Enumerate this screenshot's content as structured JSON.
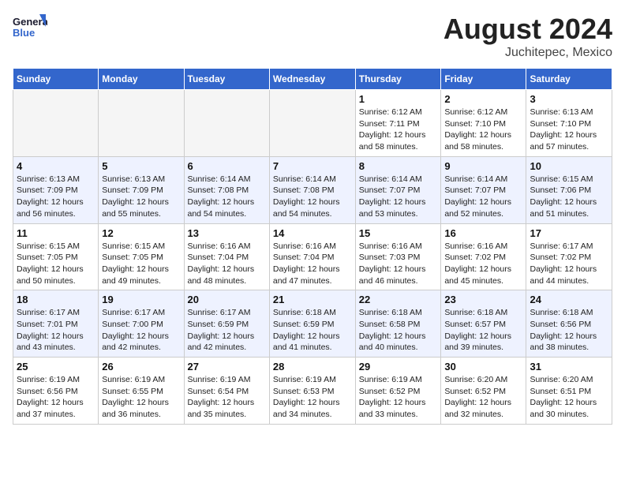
{
  "logo": {
    "line1": "General",
    "line2": "Blue"
  },
  "title": "August 2024",
  "location": "Juchitepec, Mexico",
  "weekdays": [
    "Sunday",
    "Monday",
    "Tuesday",
    "Wednesday",
    "Thursday",
    "Friday",
    "Saturday"
  ],
  "weeks": [
    [
      {
        "day": "",
        "info": "",
        "empty": true
      },
      {
        "day": "",
        "info": "",
        "empty": true
      },
      {
        "day": "",
        "info": "",
        "empty": true
      },
      {
        "day": "",
        "info": "",
        "empty": true
      },
      {
        "day": "1",
        "info": "Sunrise: 6:12 AM\nSunset: 7:11 PM\nDaylight: 12 hours\nand 58 minutes."
      },
      {
        "day": "2",
        "info": "Sunrise: 6:12 AM\nSunset: 7:10 PM\nDaylight: 12 hours\nand 58 minutes."
      },
      {
        "day": "3",
        "info": "Sunrise: 6:13 AM\nSunset: 7:10 PM\nDaylight: 12 hours\nand 57 minutes."
      }
    ],
    [
      {
        "day": "4",
        "info": "Sunrise: 6:13 AM\nSunset: 7:09 PM\nDaylight: 12 hours\nand 56 minutes."
      },
      {
        "day": "5",
        "info": "Sunrise: 6:13 AM\nSunset: 7:09 PM\nDaylight: 12 hours\nand 55 minutes."
      },
      {
        "day": "6",
        "info": "Sunrise: 6:14 AM\nSunset: 7:08 PM\nDaylight: 12 hours\nand 54 minutes."
      },
      {
        "day": "7",
        "info": "Sunrise: 6:14 AM\nSunset: 7:08 PM\nDaylight: 12 hours\nand 54 minutes."
      },
      {
        "day": "8",
        "info": "Sunrise: 6:14 AM\nSunset: 7:07 PM\nDaylight: 12 hours\nand 53 minutes."
      },
      {
        "day": "9",
        "info": "Sunrise: 6:14 AM\nSunset: 7:07 PM\nDaylight: 12 hours\nand 52 minutes."
      },
      {
        "day": "10",
        "info": "Sunrise: 6:15 AM\nSunset: 7:06 PM\nDaylight: 12 hours\nand 51 minutes."
      }
    ],
    [
      {
        "day": "11",
        "info": "Sunrise: 6:15 AM\nSunset: 7:05 PM\nDaylight: 12 hours\nand 50 minutes."
      },
      {
        "day": "12",
        "info": "Sunrise: 6:15 AM\nSunset: 7:05 PM\nDaylight: 12 hours\nand 49 minutes."
      },
      {
        "day": "13",
        "info": "Sunrise: 6:16 AM\nSunset: 7:04 PM\nDaylight: 12 hours\nand 48 minutes."
      },
      {
        "day": "14",
        "info": "Sunrise: 6:16 AM\nSunset: 7:04 PM\nDaylight: 12 hours\nand 47 minutes."
      },
      {
        "day": "15",
        "info": "Sunrise: 6:16 AM\nSunset: 7:03 PM\nDaylight: 12 hours\nand 46 minutes."
      },
      {
        "day": "16",
        "info": "Sunrise: 6:16 AM\nSunset: 7:02 PM\nDaylight: 12 hours\nand 45 minutes."
      },
      {
        "day": "17",
        "info": "Sunrise: 6:17 AM\nSunset: 7:02 PM\nDaylight: 12 hours\nand 44 minutes."
      }
    ],
    [
      {
        "day": "18",
        "info": "Sunrise: 6:17 AM\nSunset: 7:01 PM\nDaylight: 12 hours\nand 43 minutes."
      },
      {
        "day": "19",
        "info": "Sunrise: 6:17 AM\nSunset: 7:00 PM\nDaylight: 12 hours\nand 42 minutes."
      },
      {
        "day": "20",
        "info": "Sunrise: 6:17 AM\nSunset: 6:59 PM\nDaylight: 12 hours\nand 42 minutes."
      },
      {
        "day": "21",
        "info": "Sunrise: 6:18 AM\nSunset: 6:59 PM\nDaylight: 12 hours\nand 41 minutes."
      },
      {
        "day": "22",
        "info": "Sunrise: 6:18 AM\nSunset: 6:58 PM\nDaylight: 12 hours\nand 40 minutes."
      },
      {
        "day": "23",
        "info": "Sunrise: 6:18 AM\nSunset: 6:57 PM\nDaylight: 12 hours\nand 39 minutes."
      },
      {
        "day": "24",
        "info": "Sunrise: 6:18 AM\nSunset: 6:56 PM\nDaylight: 12 hours\nand 38 minutes."
      }
    ],
    [
      {
        "day": "25",
        "info": "Sunrise: 6:19 AM\nSunset: 6:56 PM\nDaylight: 12 hours\nand 37 minutes."
      },
      {
        "day": "26",
        "info": "Sunrise: 6:19 AM\nSunset: 6:55 PM\nDaylight: 12 hours\nand 36 minutes."
      },
      {
        "day": "27",
        "info": "Sunrise: 6:19 AM\nSunset: 6:54 PM\nDaylight: 12 hours\nand 35 minutes."
      },
      {
        "day": "28",
        "info": "Sunrise: 6:19 AM\nSunset: 6:53 PM\nDaylight: 12 hours\nand 34 minutes."
      },
      {
        "day": "29",
        "info": "Sunrise: 6:19 AM\nSunset: 6:52 PM\nDaylight: 12 hours\nand 33 minutes."
      },
      {
        "day": "30",
        "info": "Sunrise: 6:20 AM\nSunset: 6:52 PM\nDaylight: 12 hours\nand 32 minutes."
      },
      {
        "day": "31",
        "info": "Sunrise: 6:20 AM\nSunset: 6:51 PM\nDaylight: 12 hours\nand 30 minutes."
      }
    ]
  ]
}
